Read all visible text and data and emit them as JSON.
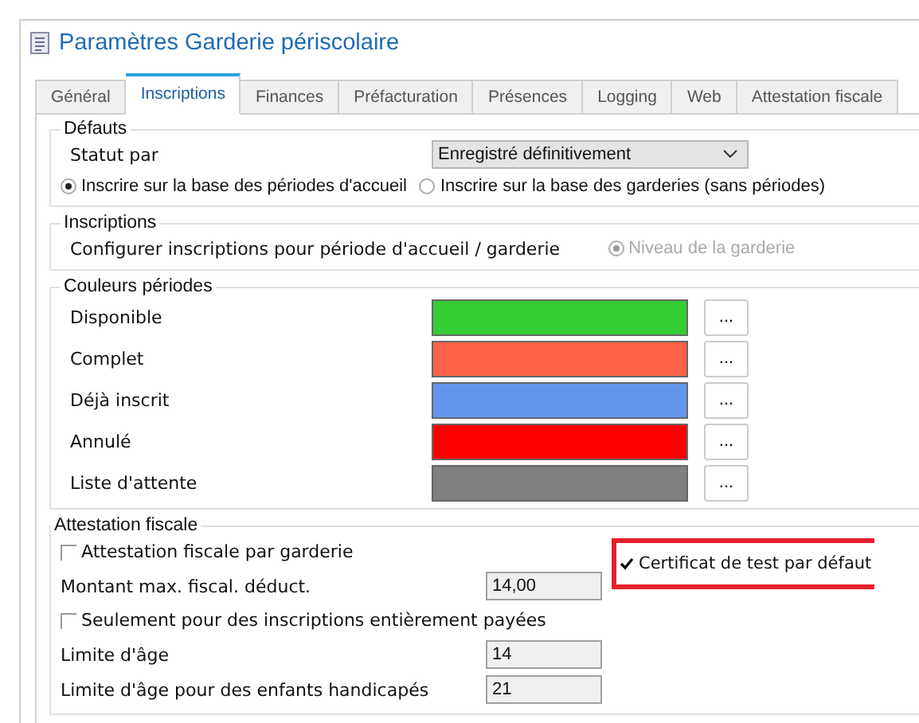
{
  "window": {
    "title": "Paramètres Garderie périscolaire"
  },
  "tabs": [
    {
      "label": "Général",
      "selected": false
    },
    {
      "label": "Inscriptions",
      "selected": true
    },
    {
      "label": "Finances",
      "selected": false
    },
    {
      "label": "Préfacturation",
      "selected": false
    },
    {
      "label": "Présences",
      "selected": false
    },
    {
      "label": "Logging",
      "selected": false
    },
    {
      "label": "Web",
      "selected": false
    },
    {
      "label": "Attestation fiscale",
      "selected": false
    }
  ],
  "defaults": {
    "legend": "Défauts",
    "status_label": "Statut par",
    "status_value": "Enregistré définitivement",
    "radios": [
      {
        "label": "Inscrire sur la base des périodes d'accueil",
        "selected": true
      },
      {
        "label": "Inscrire sur la base des garderies (sans périodes)",
        "selected": false
      }
    ]
  },
  "inscriptions": {
    "legend": "Inscriptions",
    "label": "Configurer inscriptions pour période d'accueil / garderie",
    "radio": {
      "label": "Niveau de la garderie",
      "selected": true,
      "disabled": true
    }
  },
  "period_colors": {
    "legend": "Couleurs périodes",
    "button": "...",
    "items": [
      {
        "label": "Disponible",
        "color": "#33cc33"
      },
      {
        "label": "Complet",
        "color": "#ff6347"
      },
      {
        "label": "Déjà inscrit",
        "color": "#6495ed"
      },
      {
        "label": "Annulé",
        "color": "#ff0000"
      },
      {
        "label": "Liste d'attente",
        "color": "#808080"
      }
    ]
  },
  "tax_certificate": {
    "legend": "Attestation fiscale",
    "rows": [
      {
        "kind": "checkbox",
        "label": "Attestation fiscale par garderie",
        "checked": false
      },
      {
        "kind": "field",
        "label": "Montant max. fiscal. déduct.",
        "value": "14,00"
      },
      {
        "kind": "checkbox",
        "label": "Seulement pour des inscriptions entièrement payées",
        "checked": false
      },
      {
        "kind": "field",
        "label": "Limite d'âge",
        "value": "14"
      },
      {
        "kind": "field",
        "label": "Limite d'âge pour des enfants handicapés",
        "value": "21"
      }
    ],
    "side_checkbox": {
      "label": "Certificat de test par défaut",
      "checked": true,
      "highlighted": true
    }
  }
}
